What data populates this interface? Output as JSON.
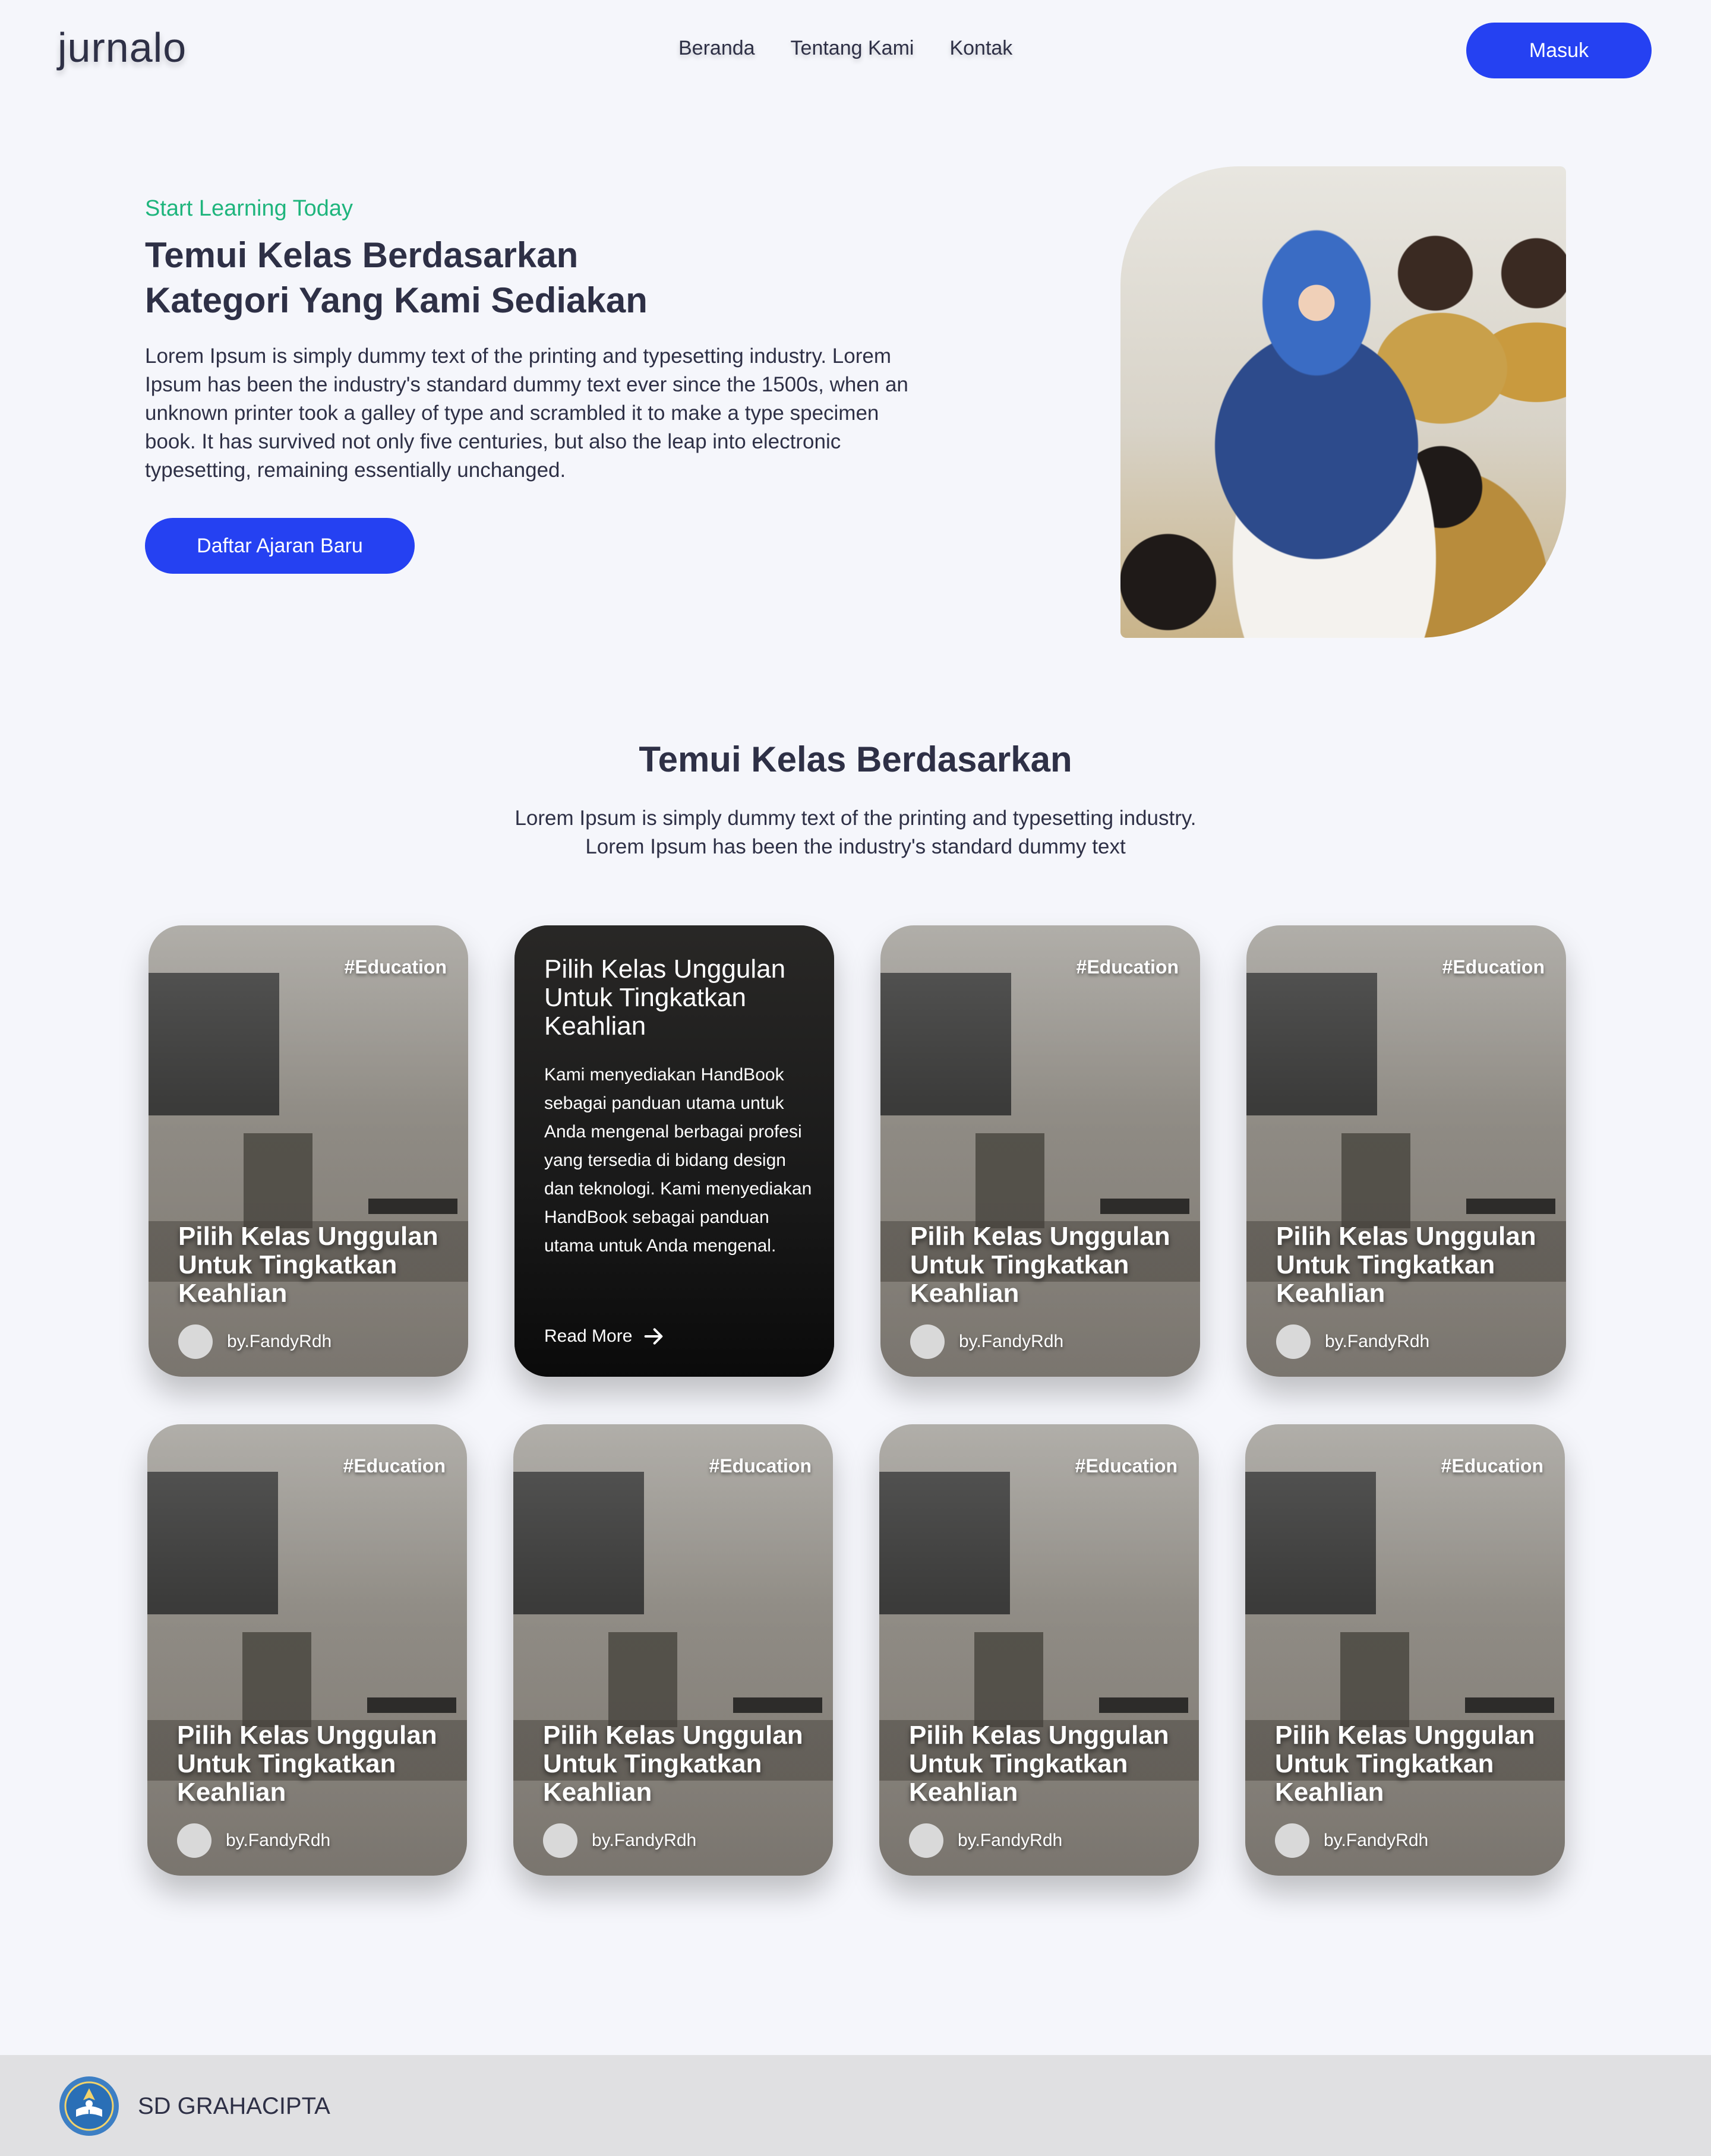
{
  "nav": {
    "logo": "jurnalo",
    "links": [
      "Beranda",
      "Tentang Kami",
      "Kontak"
    ],
    "login_label": "Masuk"
  },
  "hero": {
    "eyebrow": "Start Learning Today",
    "title_line1": "Temui Kelas Berdasarkan",
    "title_line2": "Kategori Yang Kami Sediakan",
    "description": "Lorem Ipsum is simply dummy text of the printing and typesetting industry. Lorem Ipsum has been the industry's standard dummy text ever since the 1500s, when an unknown printer took a galley of type and scrambled it to make a type specimen book. It has survived not only five centuries, but also the leap into electronic typesetting, remaining essentially unchanged.",
    "cta_label": "Daftar Ajaran Baru"
  },
  "section": {
    "title": "Temui Kelas Berdasarkan",
    "desc_line1": "Lorem Ipsum is simply dummy text of the printing and typesetting industry.",
    "desc_line2": "Lorem Ipsum has been the industry's standard dummy text"
  },
  "card": {
    "tag": "#Education",
    "title": "Pilih Kelas Unggulan Untuk Tingkatkan Keahlian",
    "author": "by.FandyRdh"
  },
  "featured_card": {
    "title": "Pilih Kelas Unggulan Untuk Tingkatkan Keahlian",
    "description": "Kami menyediakan HandBook sebagai panduan utama untuk Anda mengenal berbagai profesi yang tersedia di bidang design dan teknologi. Kami menyediakan HandBook sebagai panduan utama untuk Anda mengenal.",
    "read_more_label": "Read More",
    "read_more_icon": "arrow-right-icon"
  },
  "footer": {
    "school_name": "SD GRAHACIPTA",
    "logo_icon": "school-emblem-icon"
  },
  "colors": {
    "accent": "#2541f2",
    "eyebrow": "#1fb57d",
    "text": "#2e3046",
    "background": "#f5f6fb",
    "footer": "#e0e0e2"
  }
}
